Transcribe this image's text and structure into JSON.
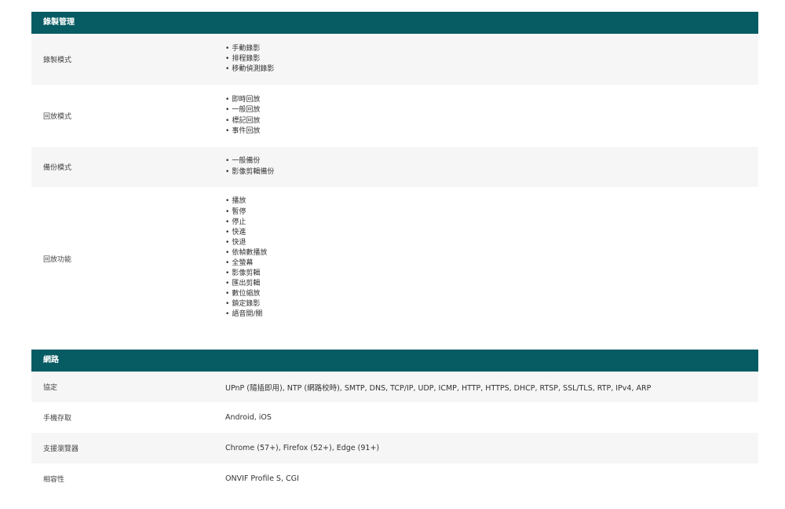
{
  "recording": {
    "title": "錄製管理",
    "rows": [
      {
        "label": "錄製模式",
        "items": [
          "手動錄影",
          "排程錄影",
          "移動偵測錄影"
        ]
      },
      {
        "label": "回放模式",
        "items": [
          "即時回放",
          "一般回放",
          "標記回放",
          "事件回放"
        ]
      },
      {
        "label": "備份模式",
        "items": [
          "一般備份",
          "影像剪輯備份"
        ]
      },
      {
        "label": "回放功能",
        "items": [
          "播放",
          "暫停",
          "停止",
          "快進",
          "快退",
          "依幀數播放",
          "全螢幕",
          "影像剪輯",
          "匯出剪輯",
          "數位縮放",
          "鎖定錄影",
          "語音開/關"
        ]
      }
    ]
  },
  "network": {
    "title": "網路",
    "rows": [
      {
        "label": "協定",
        "value": "UPnP (隨插即用), NTP (網路校時), SMTP, DNS, TCP/IP, UDP, ICMP, HTTP, HTTPS, DHCP, RTSP, SSL/TLS, RTP, IPv4, ARP"
      },
      {
        "label": "手機存取",
        "value": "Android, iOS"
      },
      {
        "label": "支援瀏覽器",
        "value": "Chrome (57+), Firefox (52+), Edge (91+)"
      },
      {
        "label": "相容性",
        "value": "ONVIF Profile S, CGI"
      }
    ]
  }
}
